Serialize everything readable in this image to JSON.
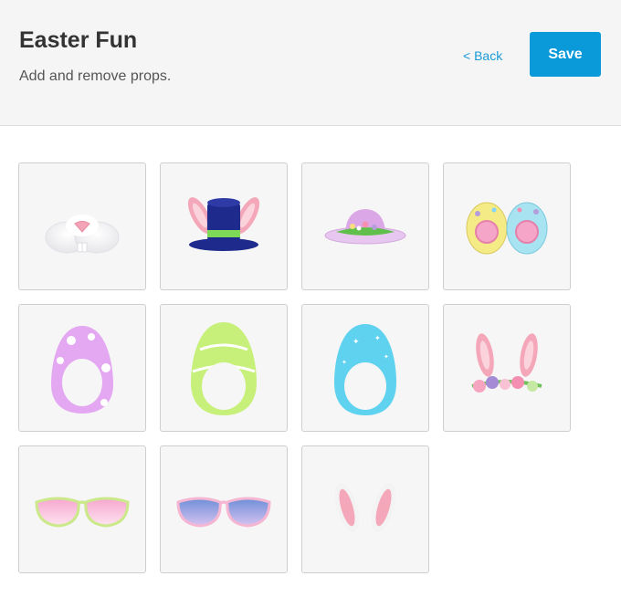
{
  "header": {
    "title": "Easter Fun",
    "subtitle": "Add and remove props.",
    "back_label": "< Back",
    "save_label": "Save"
  },
  "props": [
    {
      "icon": "bunny-nose-icon"
    },
    {
      "icon": "bunny-top-hat-icon"
    },
    {
      "icon": "easter-bonnet-icon"
    },
    {
      "icon": "egg-goggles-icon"
    },
    {
      "icon": "purple-egg-frame-icon"
    },
    {
      "icon": "green-egg-frame-icon"
    },
    {
      "icon": "blue-egg-frame-icon"
    },
    {
      "icon": "bunny-ears-flower-crown-icon"
    },
    {
      "icon": "pink-sunglasses-icon"
    },
    {
      "icon": "blue-sunglasses-icon"
    },
    {
      "icon": "bunny-ears-icon"
    }
  ],
  "colors": {
    "accent": "#0a9ad9",
    "link": "#1a9ad6",
    "tile_background": "#f6f6f6",
    "header_background": "#f5f5f5"
  }
}
